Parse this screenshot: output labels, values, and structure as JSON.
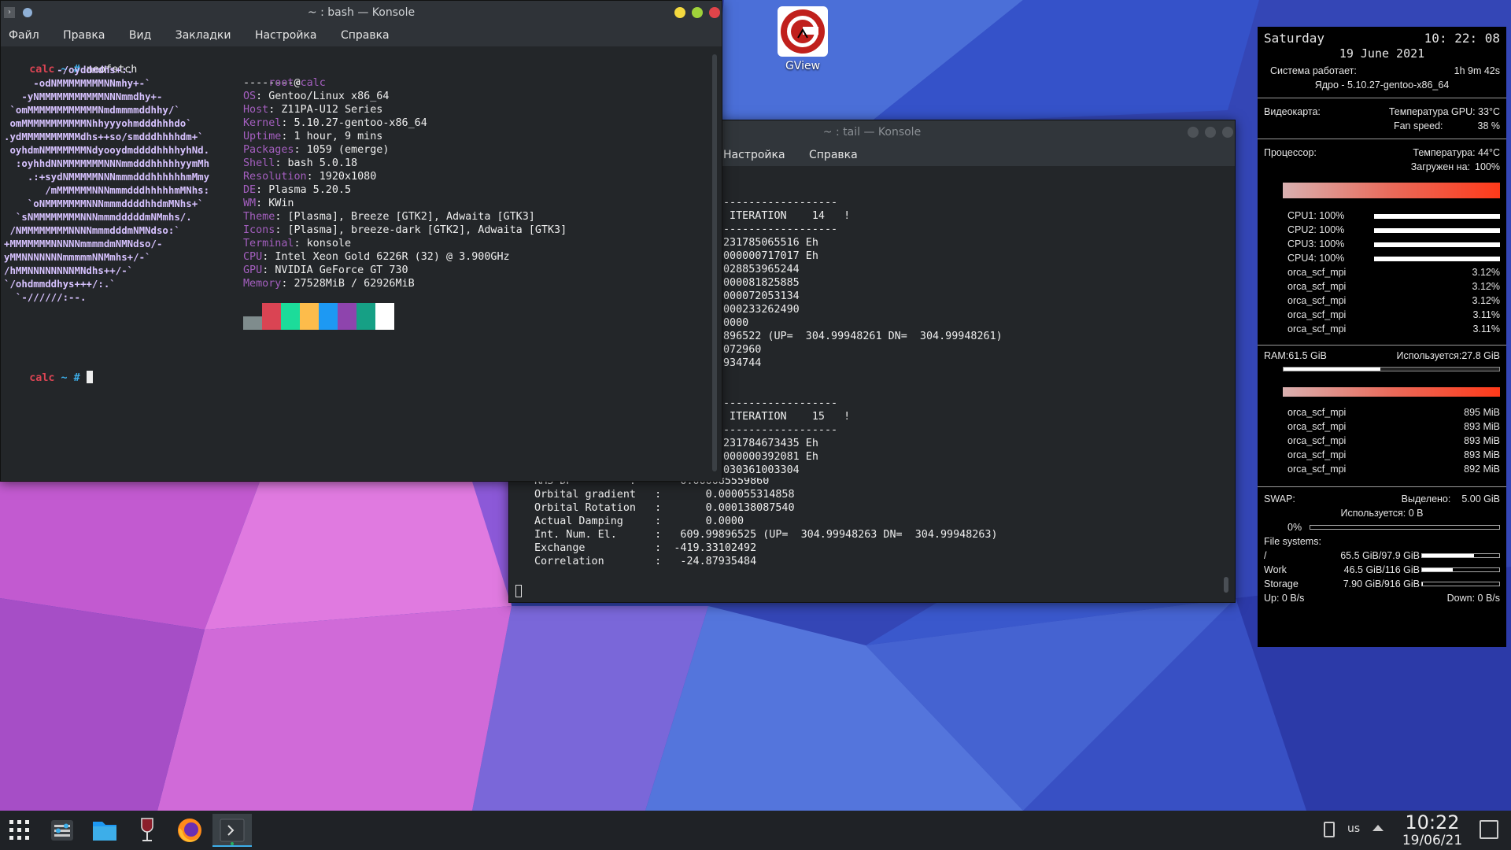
{
  "desktop": {
    "icon_label": "GView"
  },
  "bash_window": {
    "title": "~ : bash — Konsole",
    "menu": [
      "Файл",
      "Правка",
      "Вид",
      "Закладки",
      "Настройка",
      "Справка"
    ],
    "prompt_host": "calc",
    "prompt_rest": " ~ # ",
    "command": "neofetch",
    "ascii_art": [
      "         -/oyddmdhs+:.",
      "     -odNMMMMMMMMNNmhy+-`",
      "   -yNMMMMMMMMMMMNNNmmdhy+-",
      " `omMMMMMMMMMMMMNmdmmmmddhhy/`",
      " omMMMMMMMMMMMNhhyyyohmdddhhhdo`",
      ".ydMMMMMMMMMMdhs++so/smdddhhhhdm+`",
      " oyhdmNMMMMMMMNdyooydmddddhhhhyhNd.",
      "  :oyhhdNNMMMMMMMNNNmmdddhhhhhyymMh",
      "    .:+sydNMMMMMNNNmmmdddhhhhhhmMmy",
      "       /mMMMMMMNNNmmmdddhhhhhmMNhs:",
      "    `oNMMMMMMMNNNmmmddddhhdmMNhs+`",
      "  `sNMMMMMMMMNNNmmmdddddmNMmhs/.",
      " /NMMMMMMMMNNNNmmmdddmNMNdso:`",
      "+MMMMMMMNNNNNmmmmdmNMNdso/-",
      "yMMNNNNNNNmmmmmNNMmhs+/-`",
      "/hMMNNNNNNNNMNdhs++/-`",
      "`/ohdmmddhys+++/:.`",
      "  `-//////:--."
    ],
    "user": "root",
    "at": "@",
    "host": "calc",
    "separator": "---------",
    "info": [
      {
        "key": "OS",
        "value": "Gentoo/Linux x86_64"
      },
      {
        "key": "Host",
        "value": "Z11PA-U12 Series"
      },
      {
        "key": "Kernel",
        "value": "5.10.27-gentoo-x86_64"
      },
      {
        "key": "Uptime",
        "value": "1 hour, 9 mins"
      },
      {
        "key": "Packages",
        "value": "1059 (emerge)"
      },
      {
        "key": "Shell",
        "value": "bash 5.0.18"
      },
      {
        "key": "Resolution",
        "value": "1920x1080"
      },
      {
        "key": "DE",
        "value": "Plasma 5.20.5"
      },
      {
        "key": "WM",
        "value": "KWin"
      },
      {
        "key": "Theme",
        "value": "[Plasma], Breeze [GTK2], Adwaita [GTK3]"
      },
      {
        "key": "Icons",
        "value": "[Plasma], breeze-dark [GTK2], Adwaita [GTK3]"
      },
      {
        "key": "Terminal",
        "value": "konsole"
      },
      {
        "key": "CPU",
        "value": "Intel Xeon Gold 6226R (32) @ 3.900GHz"
      },
      {
        "key": "GPU",
        "value": "NVIDIA GeForce GT 730"
      },
      {
        "key": "Memory",
        "value": "27528MiB / 62926MiB"
      }
    ],
    "palette": [
      "#7f8c8d",
      "#da4453",
      "#1cdc9a",
      "#fdbc4b",
      "#1d99f3",
      "#8e44ad",
      "#16a085",
      "#ffffff"
    ]
  },
  "tail_window": {
    "title": "~ : tail — Konsole",
    "menu": [
      "Настройка",
      "Справка"
    ],
    "visible_lines": [
      "------------------",
      " ITERATION    14   !",
      "------------------",
      "231785065516 Eh",
      "000000717017 Eh",
      "028853965244",
      "000081825885",
      "000072053134",
      "000233262490",
      "0000",
      "896522 (UP=  304.99948261 DN=  304.99948261)",
      "072960",
      "934744",
      "",
      "",
      "------------------",
      " ITERATION    15   !",
      "------------------",
      "231784673435 Eh",
      "000000392081 Eh",
      "030361003304"
    ],
    "bottom_lines": [
      "RMS-DP         :       0.000085559860",
      "Orbital gradient   :       0.000055314858",
      "Orbital Rotation   :       0.000138087540",
      "Actual Damping     :       0.0000",
      "Int. Num. El.      :   609.99896525 (UP=  304.99948263 DN=  304.99948263)",
      "Exchange           :  -419.33102492",
      "Correlation        :   -24.87935484"
    ]
  },
  "conky": {
    "day": "Saturday",
    "time": "10: 22: 08",
    "date": "19 June 2021",
    "uptime_label": "Система работает:",
    "uptime_value": "1h 9m 42s",
    "kernel": "Ядро - 5.10.27-gentoo-x86_64",
    "gpu_label": "Видеокарта:",
    "gpu_temp": "Температура GPU:  33°C",
    "fan_label": "Fan speed:",
    "fan_value": "38 %",
    "cpu_label": "Процессор:",
    "cpu_temp": "Температура: 44°C",
    "cpu_load_label": "Загружен на:",
    "cpu_load_value": "100%",
    "cores": [
      {
        "label": "CPU1: 100%",
        "level": 1.0
      },
      {
        "label": "CPU2: 100%",
        "level": 1.0
      },
      {
        "label": "CPU3: 100%",
        "level": 1.0
      },
      {
        "label": "CPU4: 100%",
        "level": 1.0
      }
    ],
    "cpu_procs": [
      {
        "name": "orca_scf_mpi",
        "value": "3.12%"
      },
      {
        "name": "orca_scf_mpi",
        "value": "3.12%"
      },
      {
        "name": "orca_scf_mpi",
        "value": "3.12%"
      },
      {
        "name": "orca_scf_mpi",
        "value": "3.11%"
      },
      {
        "name": "orca_scf_mpi",
        "value": "3.11%"
      }
    ],
    "ram_label": "RAM:61.5 GiB",
    "ram_used": "Используется:27.8 GiB",
    "ram_level": 0.45,
    "mem_procs": [
      {
        "name": "orca_scf_mpi",
        "value": "895 MiB"
      },
      {
        "name": "orca_scf_mpi",
        "value": "893 MiB"
      },
      {
        "name": "orca_scf_mpi",
        "value": "893 MiB"
      },
      {
        "name": "orca_scf_mpi",
        "value": "893 MiB"
      },
      {
        "name": "orca_scf_mpi",
        "value": "892 MiB"
      }
    ],
    "swap_label": "SWAP:",
    "swap_alloc_label": "Выделено:",
    "swap_alloc_value": "5.00 GiB",
    "swap_used": "Используется: 0 B",
    "swap_pct": "0%",
    "fs_label": "File systems:",
    "filesystems": [
      {
        "name": "/",
        "value": "65.5 GiB/97.9 GiB",
        "level": 0.67
      },
      {
        "name": "Work",
        "value": "46.5 GiB/116 GiB",
        "level": 0.4
      },
      {
        "name": "Storage",
        "value": "7.90 GiB/916 GiB",
        "level": 0.01
      }
    ],
    "net_up": "Up: 0 B/s",
    "net_down": "Down: 0 B/s"
  },
  "taskbar": {
    "keyboard_layout": "us",
    "clock_time": "10:22",
    "clock_date": "19/06/21"
  },
  "colors": {
    "prompt_red": "#da4453",
    "neofetch_purple": "#a45fbf",
    "accent_blue": "#3daee9"
  }
}
